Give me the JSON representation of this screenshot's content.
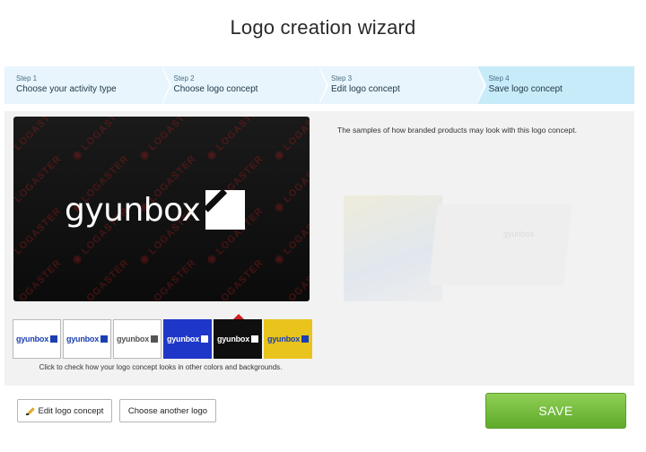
{
  "title": "Logo creation wizard",
  "steps": [
    {
      "num": "Step 1",
      "label": "Choose your activity type"
    },
    {
      "num": "Step 2",
      "label": "Choose logo concept"
    },
    {
      "num": "Step 3",
      "label": "Edit logo concept"
    },
    {
      "num": "Step 4",
      "label": "Save logo concept"
    }
  ],
  "active_step": 4,
  "preview": {
    "logo_text": "gyunbox",
    "watermark": "LOGASTER"
  },
  "swatches": [
    {
      "label": "gyunbox"
    },
    {
      "label": "gyunbox"
    },
    {
      "label": "gyunbox"
    },
    {
      "label": "gyunbox"
    },
    {
      "label": "gyunbox"
    },
    {
      "label": "gyunbox"
    }
  ],
  "selected_swatch": 5,
  "swatch_hint": "Click to check how your logo concept looks in other colors and backgrounds.",
  "samples_text": "The samples of how branded products may look with this logo concept.",
  "sample_logo_text": "gyunbox",
  "buttons": {
    "edit": "Edit logo concept",
    "another": "Choose another logo",
    "save": "SAVE"
  },
  "colors": {
    "save_green": "#6bb83a",
    "active_step_bg": "#c8ebf9",
    "selected_marker": "#d31f1f"
  }
}
